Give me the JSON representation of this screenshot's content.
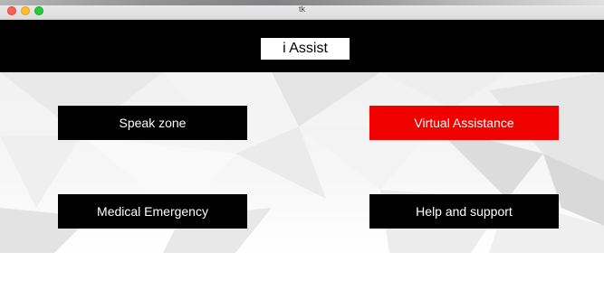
{
  "window": {
    "title": "tk"
  },
  "header": {
    "title": "i Assist"
  },
  "buttons": {
    "speak_zone": "Speak zone",
    "virtual_assistance": "Virtual Assistance",
    "medical_emergency": "Medical Emergency",
    "help_support": "Help and support"
  },
  "colors": {
    "header_bg": "#000000",
    "button_bg": "#000000",
    "button_active_bg": "#f20000",
    "button_text": "#ffffff"
  }
}
